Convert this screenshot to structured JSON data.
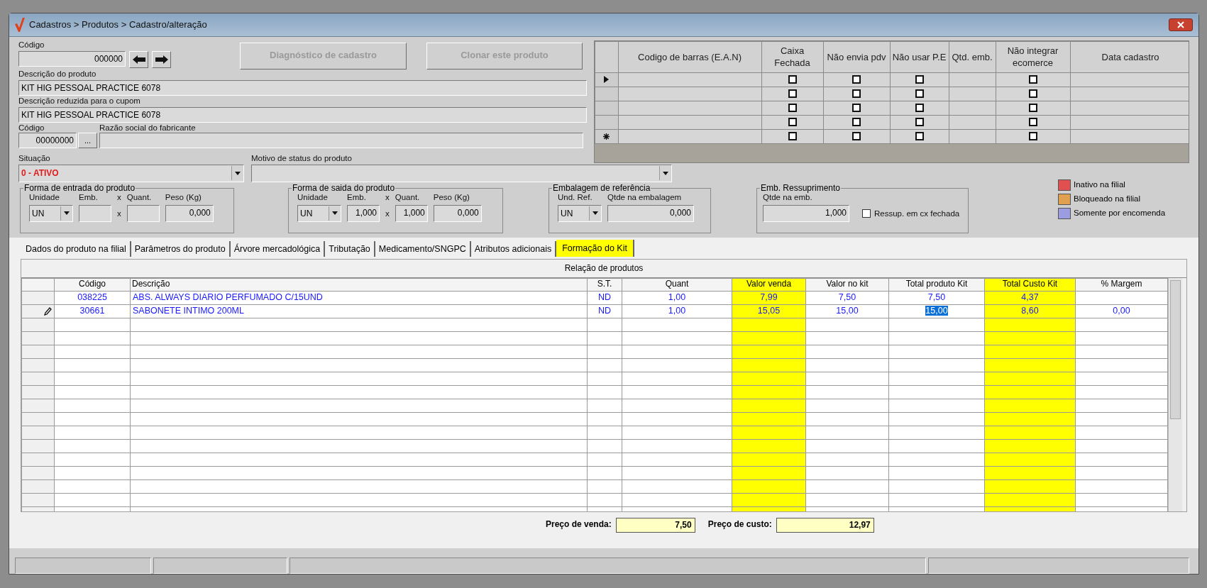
{
  "window": {
    "title": "Cadastros > Produtos > Cadastro/alteração"
  },
  "product": {
    "codigo": {
      "label": "Código",
      "value": "000000"
    },
    "buttons": [
      {
        "label": "Diagnóstico de cadastro",
        "disabled": true
      },
      {
        "label": "Clonar este produto",
        "disabled": true
      }
    ],
    "descricao": {
      "label": "Descrição  do produto",
      "value": "KIT HIG PESSOAL PRACTICE 6078"
    },
    "descricao_reduzida": {
      "label": "Descrição reduzida para o cupom",
      "value": "KIT HIG PESSOAL PRACTICE 6078"
    },
    "fabricante_codigo": {
      "label": "Código",
      "value": "00000000"
    },
    "fabricante_button": "...",
    "razao_social": {
      "label": "Razão social do fabricante"
    },
    "situacao": {
      "label": "Situação",
      "value": "0 - ATIVO"
    },
    "motivo": {
      "label": "Motivo de status do produto"
    }
  },
  "barcodes": {
    "columns": [
      {
        "label": "Codigo de barras (E.A.N)",
        "kind": "text"
      },
      {
        "label": "Caixa Fechada",
        "kind": "check"
      },
      {
        "label": "Não envia pdv",
        "kind": "check"
      },
      {
        "label": "Não usar P.E",
        "kind": "check"
      },
      {
        "label": "Qtd. emb.",
        "kind": "text"
      },
      {
        "label": "Não integrar ecomerce",
        "kind": "check"
      },
      {
        "label": "Data cadastro",
        "kind": "text"
      }
    ],
    "rows": [
      {
        "current": true,
        "new_row": false,
        "checked": [
          false,
          false,
          false,
          false
        ]
      },
      {
        "current": false,
        "new_row": false,
        "checked": [
          false,
          false,
          false,
          false
        ]
      },
      {
        "current": false,
        "new_row": false,
        "checked": [
          false,
          false,
          false,
          false
        ]
      },
      {
        "current": false,
        "new_row": false,
        "checked": [
          false,
          false,
          false,
          false
        ]
      },
      {
        "current": false,
        "new_row": true,
        "checked": [
          false,
          false,
          false,
          false
        ]
      }
    ]
  },
  "groups": [
    {
      "title": "Forma de entrada do produto",
      "fields": [
        {
          "kind": "select",
          "label": "Unidade",
          "value": "UN"
        },
        {
          "kind": "input",
          "label": "Emb."
        },
        {
          "kind": "times",
          "label": "x",
          "value": "x"
        },
        {
          "kind": "input",
          "label": "Quant."
        },
        {
          "kind": "input",
          "label": "Peso (Kg)",
          "value": "0,000"
        }
      ]
    },
    {
      "title": "Forma de saida do produto",
      "fields": [
        {
          "kind": "select",
          "label": "Unidade",
          "value": "UN"
        },
        {
          "kind": "input",
          "label": "Emb.",
          "value": "1,000"
        },
        {
          "kind": "times",
          "label": "x",
          "value": "x"
        },
        {
          "kind": "input",
          "label": "Quant.",
          "value": "1,000"
        },
        {
          "kind": "input",
          "label": "Peso (Kg)",
          "value": "0,000"
        }
      ]
    },
    {
      "title": "Embalagem de referência",
      "fields": [
        {
          "kind": "select",
          "label": "Und. Ref.",
          "value": "UN"
        },
        {
          "kind": "input",
          "label": "Qtde na embalagem",
          "value": "0,000"
        }
      ]
    },
    {
      "title": "Emb. Ressuprimento",
      "fields": [
        {
          "kind": "input",
          "label": "Qtde na emb.",
          "value": "1,000"
        },
        {
          "kind": "checkbox",
          "label": "Ressup. em cx fechada",
          "checked": false
        }
      ]
    }
  ],
  "legend": [
    {
      "label": "Inativo na filial",
      "color": "#e05050"
    },
    {
      "label": "Bloqueado na filial",
      "color": "#e0a050"
    },
    {
      "label": "Somente por encomenda",
      "color": "#9c9ce0"
    }
  ],
  "tabs": [
    {
      "label": "Dados do produto na filial",
      "selected": false
    },
    {
      "label": "Parâmetros do produto",
      "selected": false
    },
    {
      "label": "Árvore mercadológica",
      "selected": false
    },
    {
      "label": "Tributação",
      "selected": false
    },
    {
      "label": "Medicamento/SNGPC",
      "selected": false
    },
    {
      "label": "Atributos adicionais",
      "selected": false
    },
    {
      "label": "Formação do Kit",
      "selected": true
    }
  ],
  "kit": {
    "title": "Relação de produtos",
    "columns": [
      {
        "label": "Código",
        "kind": "code",
        "highlighted": false
      },
      {
        "label": "Descrição",
        "kind": "text",
        "highlighted": false
      },
      {
        "label": "S.T.",
        "kind": "code",
        "highlighted": false
      },
      {
        "label": "Quant",
        "kind": "number",
        "highlighted": false
      },
      {
        "label": "Valor venda",
        "kind": "number",
        "highlighted": true
      },
      {
        "label": "Valor no kit",
        "kind": "number",
        "highlighted": false
      },
      {
        "label": "Total produto Kit",
        "kind": "number",
        "highlighted": false
      },
      {
        "label": "Total Custo Kit",
        "kind": "number",
        "highlighted": true
      },
      {
        "label": "% Margem",
        "kind": "number",
        "highlighted": false
      }
    ],
    "rows": [
      {
        "editing": false,
        "cells": [
          {
            "text": "038225",
            "selected": false
          },
          {
            "text": "ABS. ALWAYS DIARIO PERFUMADO C/15UND",
            "selected": false
          },
          {
            "text": "ND",
            "selected": false
          },
          {
            "text": "1,00",
            "selected": false
          },
          {
            "text": "7,99",
            "selected": false
          },
          {
            "text": "7,50",
            "selected": false
          },
          {
            "text": "7,50",
            "selected": false
          },
          {
            "text": "4,37",
            "selected": false
          },
          {
            "selected": false
          }
        ]
      },
      {
        "editing": true,
        "cells": [
          {
            "text": "30661",
            "selected": false
          },
          {
            "text": "SABONETE INTIMO 200ML",
            "selected": false
          },
          {
            "text": "ND",
            "selected": false
          },
          {
            "text": "1,00",
            "selected": false
          },
          {
            "text": "15,05",
            "selected": false
          },
          {
            "text": "15,00",
            "selected": false
          },
          {
            "text": "15,00",
            "selected": true
          },
          {
            "text": "8,60",
            "selected": false
          },
          {
            "text": "0,00",
            "selected": false
          }
        ]
      }
    ]
  },
  "totals": [
    {
      "label": "Preço de venda:",
      "value": "7,50"
    },
    {
      "label": "Preço de custo:",
      "value": "12,97"
    }
  ]
}
